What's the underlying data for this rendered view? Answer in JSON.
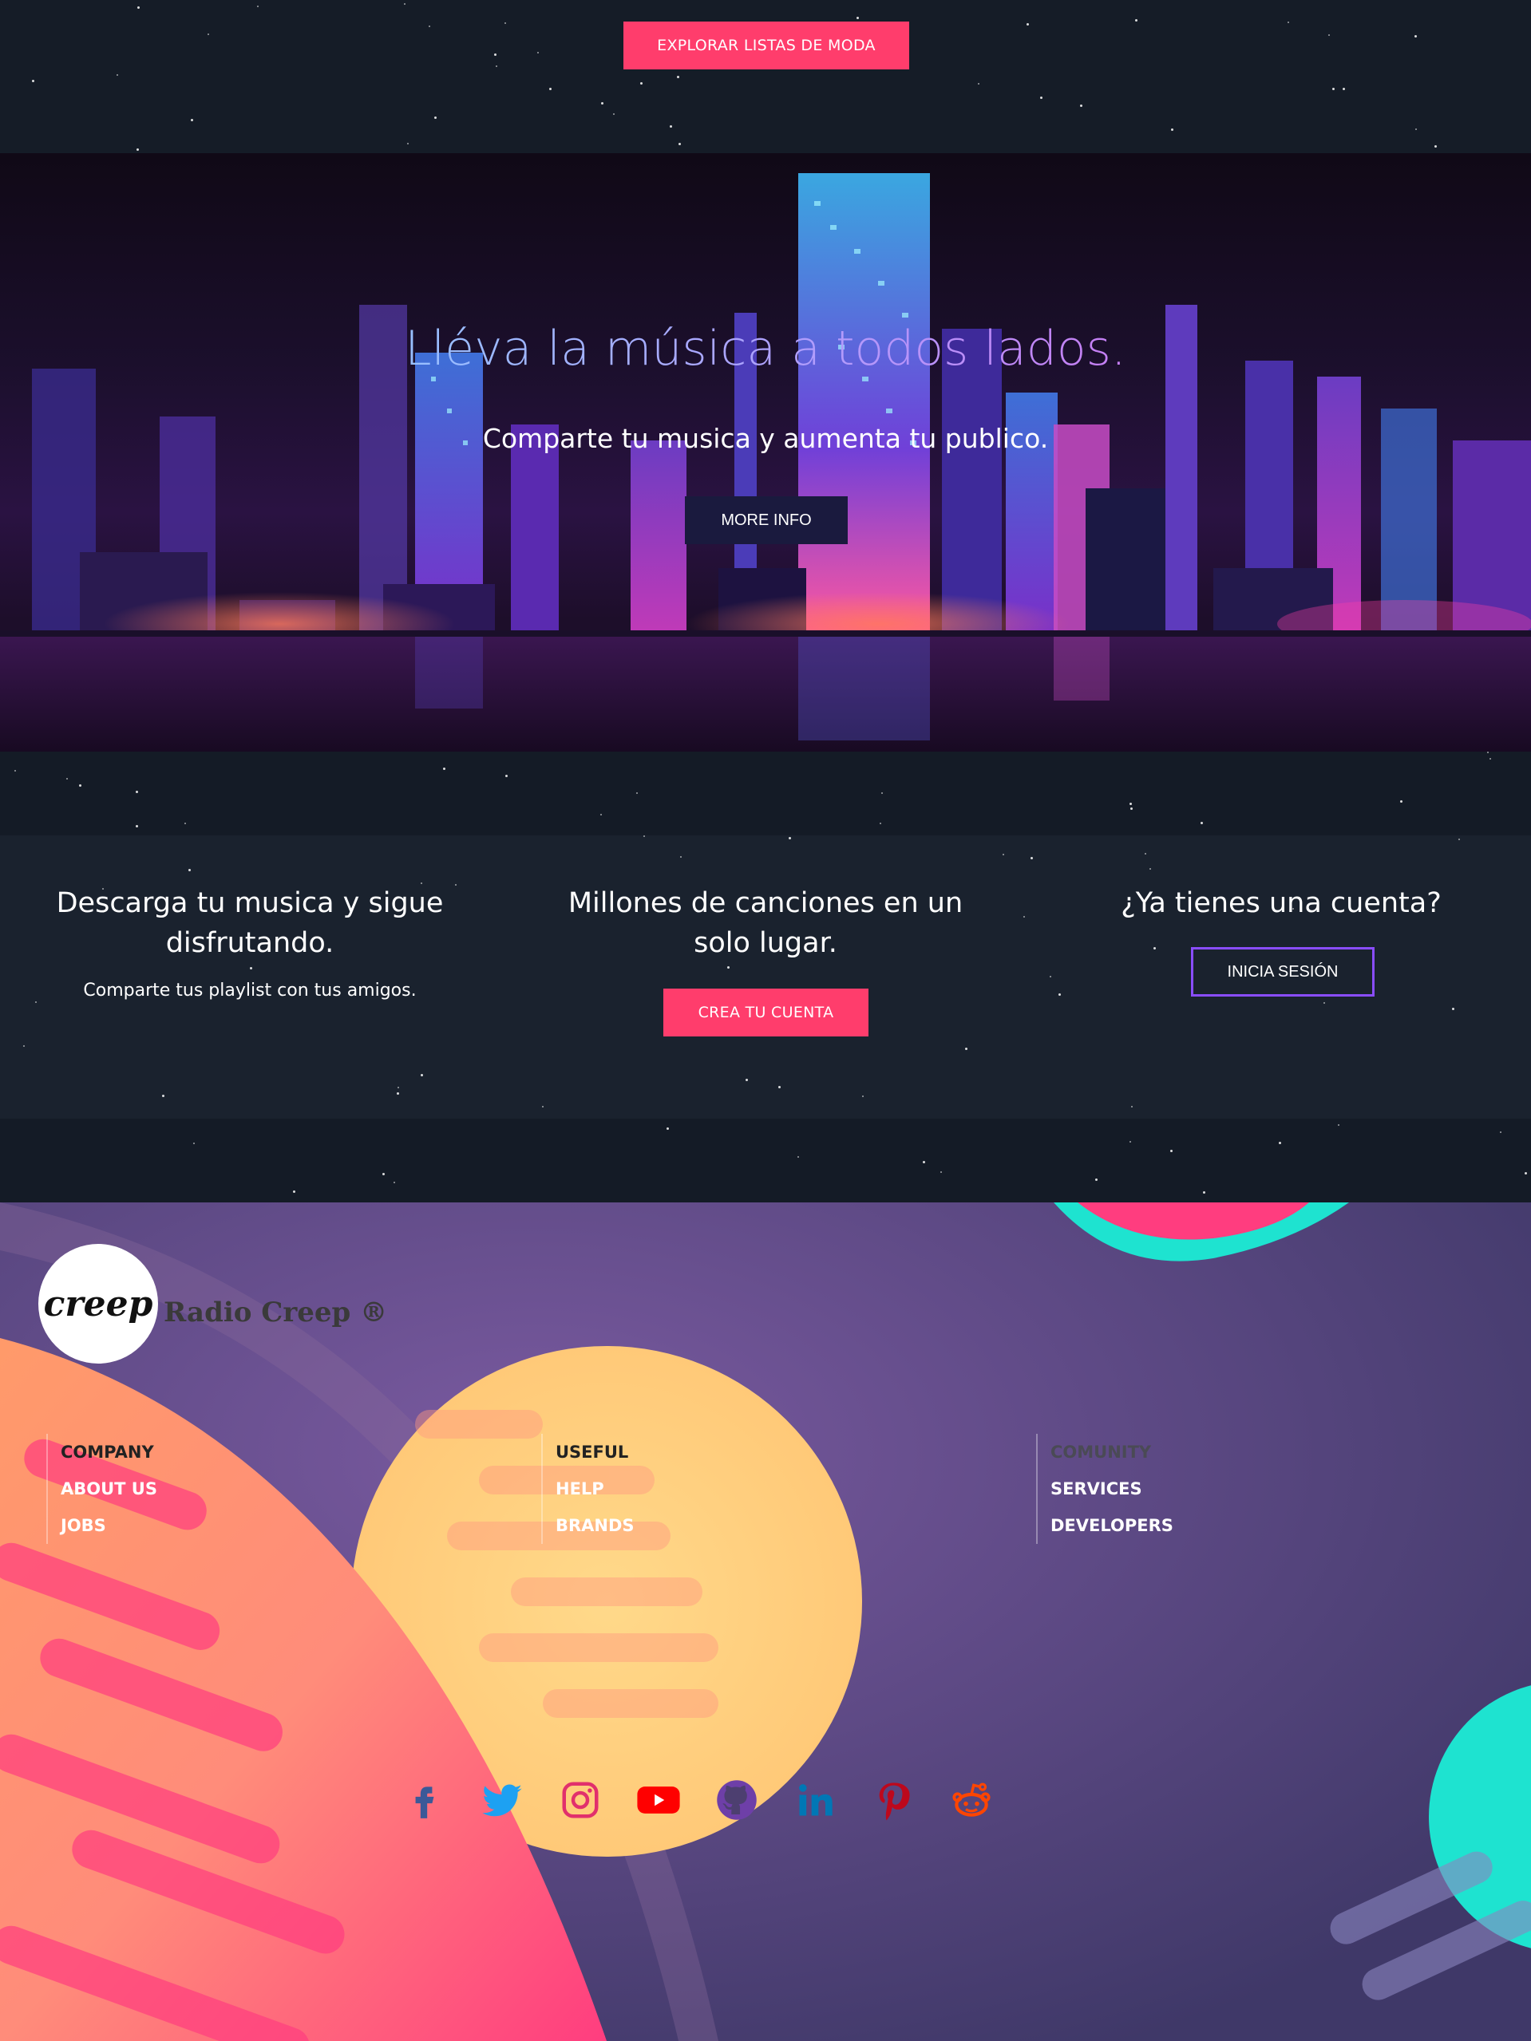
{
  "top": {
    "explore_label": "EXPLORAR LISTAS DE MODA"
  },
  "hero": {
    "title": "Lléva la música a todos lados.",
    "subtitle": "Comparte tu musica y aumenta tu publico.",
    "more_label": "MORE INFO"
  },
  "features": {
    "download_title": "Descarga tu musica y sigue disfrutando.",
    "download_text": "Comparte tus playlist con tus amigos.",
    "songs_title": "Millones de canciones en un solo lugar.",
    "create_label": "CREA TU CUENTA",
    "account_title": "¿Ya tienes una cuenta?",
    "login_label": "INICIA SESIÓN"
  },
  "footer": {
    "logo_text": "creep",
    "brand": "Radio Creep ®",
    "columns": [
      {
        "heading": "COMPANY",
        "items": [
          "ABOUT US",
          "JOBS"
        ]
      },
      {
        "heading": "USEFUL",
        "items": [
          "HELP",
          "BRANDS"
        ]
      },
      {
        "heading": "COMUNITY",
        "items": [
          "SERVICES",
          "DEVELOPERS"
        ]
      }
    ],
    "social": [
      {
        "name": "facebook-icon",
        "color": "#3b5998"
      },
      {
        "name": "twitter-icon",
        "color": "#1da1f2"
      },
      {
        "name": "instagram-icon",
        "color": "#e1306c"
      },
      {
        "name": "youtube-icon",
        "color": "#ff0000"
      },
      {
        "name": "github-icon",
        "color": "#6e3fa8"
      },
      {
        "name": "linkedin-icon",
        "color": "#0077b5"
      },
      {
        "name": "pinterest-icon",
        "color": "#bd081c"
      },
      {
        "name": "reddit-icon",
        "color": "#ff4500"
      }
    ]
  },
  "colors": {
    "accent_pink": "#ff3d6c",
    "accent_purple": "#8a4dff",
    "dark_bg": "#1a222e"
  }
}
